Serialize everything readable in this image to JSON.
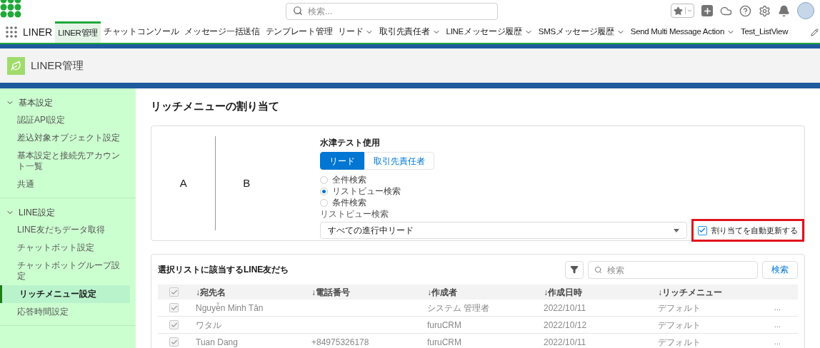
{
  "header": {
    "search": {
      "placeholder": "検索..."
    }
  },
  "nav": {
    "app_name": "LINER",
    "tabs": [
      {
        "label": "LINER管理",
        "selected": true,
        "has_menu": false
      },
      {
        "label": "チャットコンソール",
        "selected": false,
        "has_menu": false
      },
      {
        "label": "メッセージ一括送信",
        "selected": false,
        "has_menu": false
      },
      {
        "label": "テンプレート管理",
        "selected": false,
        "has_menu": false
      },
      {
        "label": "リード",
        "selected": false,
        "has_menu": true
      },
      {
        "label": "取引先責任者",
        "selected": false,
        "has_menu": true
      },
      {
        "label": "LINEメッセージ履歴",
        "selected": false,
        "has_menu": true
      },
      {
        "label": "SMSメッセージ履歴",
        "selected": false,
        "has_menu": true
      },
      {
        "label": "Send Multi Message Action",
        "selected": false,
        "has_menu": true
      },
      {
        "label": "Test_ListView",
        "selected": false,
        "has_menu": false
      }
    ]
  },
  "page_header": {
    "title": "LINER管理"
  },
  "sidebar": {
    "sections": [
      {
        "label": "基本設定",
        "expanded": true,
        "items": [
          {
            "label": "認証API設定",
            "selected": false
          },
          {
            "label": "差込対象オブジェクト設定",
            "selected": false
          },
          {
            "label": "基本設定と接続先アカウント一覧",
            "selected": false
          },
          {
            "label": "共通",
            "selected": false
          }
        ]
      },
      {
        "label": "LINE設定",
        "expanded": true,
        "items": [
          {
            "label": "LINE友だちデータ取得",
            "selected": false
          },
          {
            "label": "チャットボット設定",
            "selected": false
          },
          {
            "label": "チャットボットグループ設定",
            "selected": false
          },
          {
            "label": "リッチメニュー設定",
            "selected": true
          },
          {
            "label": "応答時間設定",
            "selected": false
          }
        ]
      }
    ]
  },
  "main": {
    "title": "リッチメニューの割り当て",
    "preview": {
      "area_a": "A",
      "area_b": "B"
    },
    "form": {
      "heading": "水津テスト使用",
      "object_tabs": [
        {
          "label": "リード",
          "selected": true
        },
        {
          "label": "取引先責任者",
          "selected": false
        }
      ],
      "search_modes": [
        {
          "label": "全件検索",
          "selected": false
        },
        {
          "label": "リストビュー検索",
          "selected": true
        },
        {
          "label": "条件検索",
          "selected": false
        }
      ],
      "listview": {
        "label": "リストビュー検索",
        "value": "すべての進行中リード"
      },
      "auto_update": {
        "label": "割り当てを自動更新する",
        "checked": true,
        "highlighted": true
      }
    },
    "friends": {
      "title": "選択リストに該当するLINE友だち",
      "search": {
        "placeholder": "検索"
      },
      "search_button": "検索",
      "columns": [
        "↓宛先名",
        "↓電話番号",
        "↓作成者",
        "↓作成日時",
        "↓リッチメニュー"
      ],
      "header_checked": true,
      "rows": [
        {
          "checked": true,
          "cells": [
            "Nguyễn Minh Tân",
            "",
            "システム 管理者",
            "2022/10/11",
            "デフォルト"
          ],
          "more": "..."
        },
        {
          "checked": true,
          "cells": [
            "ワタル",
            "",
            "furuCRM",
            "2022/10/12",
            "デフォルト"
          ],
          "more": "..."
        },
        {
          "checked": true,
          "cells": [
            "Tuan Dang",
            "+84975326178",
            "furuCRM",
            "2022/10/11",
            "デフォルト"
          ],
          "more": "..."
        }
      ]
    }
  }
}
